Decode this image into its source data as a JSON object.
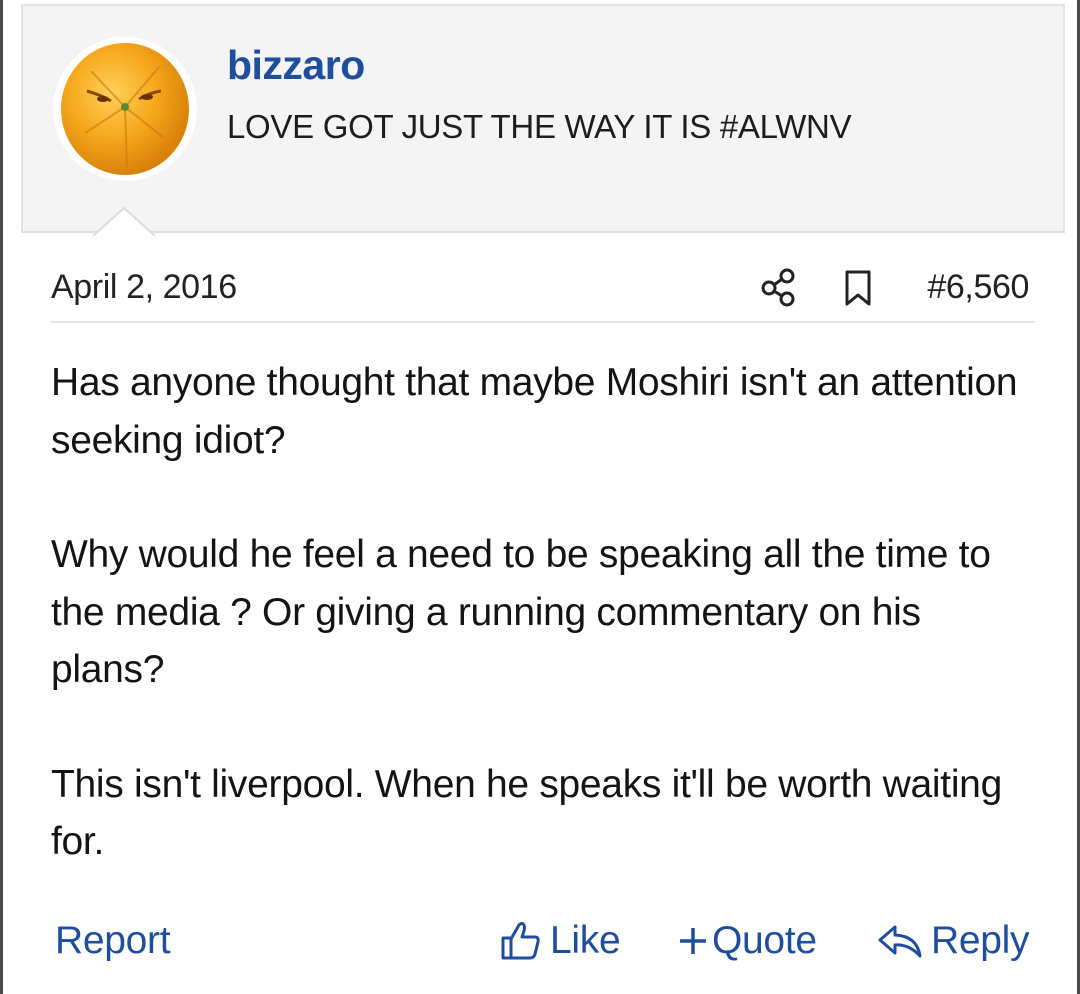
{
  "user": {
    "avatar_icon": "orange-fruit-face-avatar",
    "username": "bizzaro",
    "title": "LOVE GOT JUST THE WAY IT IS #ALWNV"
  },
  "post": {
    "date": "April 2, 2016",
    "number": "#6,560",
    "paragraphs": [
      "Has anyone thought that maybe Moshiri isn't an attention seeking idiot?",
      "Why would he feel a need to be speaking all the time to the media ? Or giving a running commentary on his plans?",
      "This isn't liverpool. When he speaks it'll be worth waiting for."
    ]
  },
  "actions": {
    "report_label": "Report",
    "like_label": "Like",
    "quote_label": "Quote",
    "reply_label": "Reply"
  },
  "icons": {
    "share": "share-icon",
    "bookmark": "bookmark-icon",
    "like": "thumbs-up-icon",
    "quote": "plus-icon",
    "reply": "reply-arrow-icon"
  },
  "colors": {
    "link": "#1f4e9c",
    "text": "#141414",
    "header_bg": "#f4f4f4",
    "avatar_orange": "#f4a21d"
  }
}
